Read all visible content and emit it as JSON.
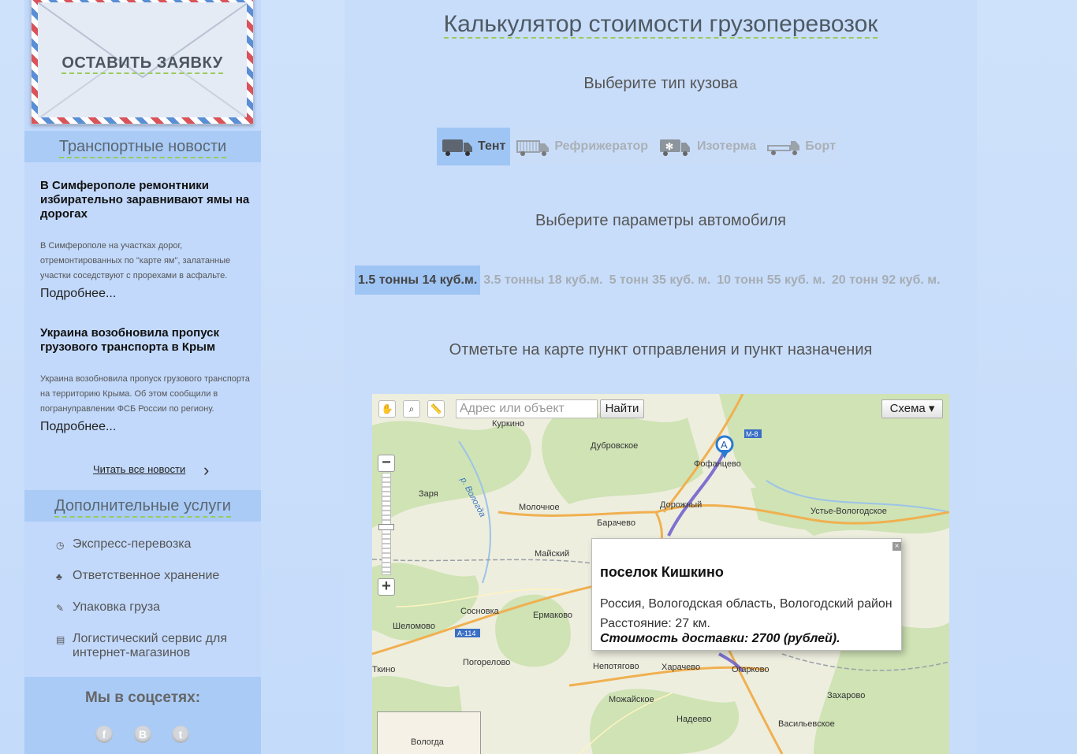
{
  "sidebar": {
    "envelope_label": "ОСТАВИТЬ ЗАЯВКУ",
    "news_heading": "Транспортные новости",
    "news": [
      {
        "title": "В Симферополе ремонтники избирательно заравнивают ямы на дорогах",
        "text": "В Симферополе на участках дорог, отремонтированных по \"карте ям\", залатанные участки соседствуют с прорехами в асфальте.",
        "more": "Подробнее..."
      },
      {
        "title": "Украина возобновила пропуск грузового транспорта в Крым",
        "text": "Украина возобновила пропуск грузового транспорта на территорию Крыма. Об этом сообщили в погрануправлении ФСБ России по региону.",
        "more": "Подробнее..."
      }
    ],
    "all_news": "Читать все новости",
    "services_heading": "Дополнительные услуги",
    "services": [
      {
        "label": "Экспресс-перевозка",
        "icon": "clock-icon"
      },
      {
        "label": "Ответственное хранение",
        "icon": "guard-icon"
      },
      {
        "label": "Упаковка груза",
        "icon": "packing-icon"
      },
      {
        "label": "Логистический сервис для интернет-магазинов",
        "icon": "cart-icon"
      }
    ],
    "social_heading": "Мы в соцсетях:",
    "social": [
      {
        "glyph": "f",
        "icon": "facebook-icon"
      },
      {
        "glyph": "B",
        "icon": "vkontakte-icon"
      },
      {
        "glyph": "t",
        "icon": "twitter-icon"
      }
    ]
  },
  "main": {
    "title": "Калькулятор стоимости грузоперевозок",
    "body_type_heading": "Выберите тип кузова",
    "body_types": [
      {
        "label": "Тент",
        "active": true
      },
      {
        "label": "Рефрижератор",
        "active": false
      },
      {
        "label": "Изотерма",
        "active": false
      },
      {
        "label": "Борт",
        "active": false
      }
    ],
    "params_heading": "Выберите параметры автомобиля",
    "params": [
      {
        "label": "1.5 тонны 14 куб.м.",
        "active": true
      },
      {
        "label": "3.5 тонны 18 куб.м.",
        "active": false
      },
      {
        "label": "5 тонн 35 куб. м.",
        "active": false
      },
      {
        "label": "10 тонн 55 куб. м.",
        "active": false
      },
      {
        "label": "20 тонн 92 куб. м.",
        "active": false
      }
    ],
    "map_heading": "Отметьте на карте пункт отправления и пункт назначения"
  },
  "map": {
    "search_placeholder": "Адрес или объект",
    "find_label": "Найти",
    "scheme_label": "Схема ▾",
    "marker_label": "A",
    "road_labels": [
      "M-8",
      "A-114"
    ],
    "places": [
      "Куркино",
      "Дубровское",
      "Фофанцево",
      "Заря",
      "Молочное",
      "Дорожный",
      "Барачево",
      "Устье-Вологодское",
      "Майский",
      "Сосновка",
      "Ермаково",
      "Шеломово",
      "Погорелово",
      "Непотягово",
      "Харачево",
      "Огарково",
      "Ткино",
      "Можайское",
      "Надеево",
      "Захарово",
      "Васильевское",
      "Вологда",
      "р. Вологда"
    ],
    "balloon": {
      "title": "поселок Кишкино",
      "address": "Россия, Вологодская область, Вологодский район",
      "distance": "Расстояние: 27 км.",
      "cost": "Стоимость доставки: 2700 (рублей)."
    }
  }
}
